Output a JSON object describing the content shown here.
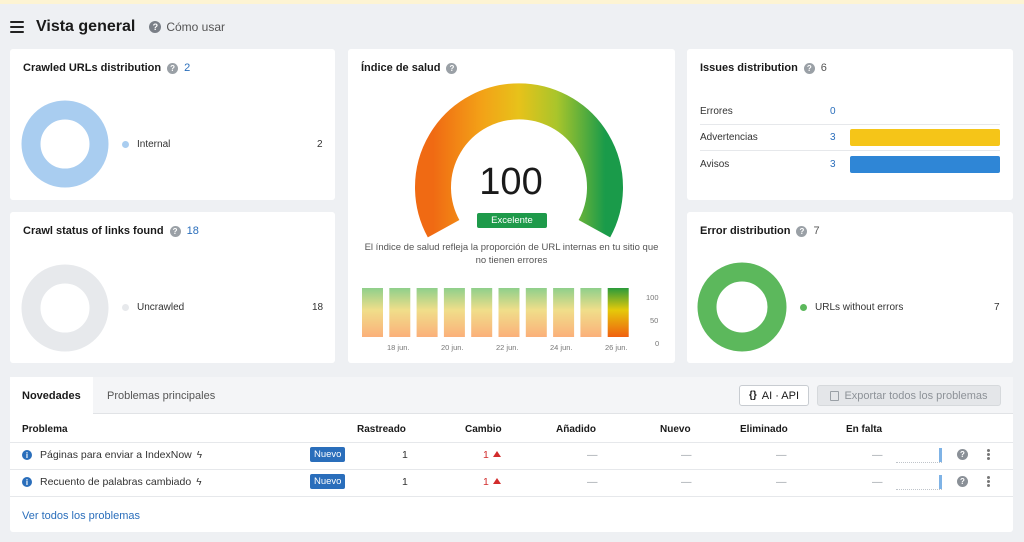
{
  "header": {
    "title": "Vista general",
    "howto": "Cómo usar"
  },
  "crawled": {
    "title": "Crawled URLs distribution",
    "count": "2",
    "legend_label": "Internal",
    "legend_value": "2",
    "color": "#a9cdf0"
  },
  "crawl_status": {
    "title": "Crawl status of links found",
    "count": "18",
    "legend_label": "Uncrawled",
    "legend_value": "18",
    "color": "#e7e9ec"
  },
  "health": {
    "title": "Índice de salud",
    "score": "100",
    "badge": "Excelente",
    "badge_color": "#1e9a4a",
    "description": "El índice de salud refleja la proporción de URL internas en tu sitio que no tienen errores",
    "history_values": [
      100,
      100,
      100,
      100,
      100,
      100,
      100,
      100,
      100,
      100
    ],
    "x_ticks": [
      "18 jun.",
      "20 jun.",
      "22 jun.",
      "24 jun.",
      "26 jun."
    ],
    "y_ticks": [
      "100",
      "50",
      "0"
    ]
  },
  "issues": {
    "title": "Issues distribution",
    "count": "6",
    "rows": [
      {
        "label": "Errores",
        "value": "0",
        "color": "#e0392b"
      },
      {
        "label": "Advertencias",
        "value": "3",
        "color": "#f5c518"
      },
      {
        "label": "Avisos",
        "value": "3",
        "color": "#2f86d6"
      }
    ]
  },
  "error_dist": {
    "title": "Error distribution",
    "count": "7",
    "legend_label": "URLs without errors",
    "legend_value": "7",
    "color": "#5cb85c"
  },
  "bottom": {
    "tabs": [
      "Novedades",
      "Problemas principales"
    ],
    "ai_button": "AI · API",
    "export_button": "Exportar todos los problemas",
    "columns": [
      "Problema",
      "Rastreado",
      "Cambio",
      "Añadido",
      "Nuevo",
      "Eliminado",
      "En falta"
    ],
    "rows": [
      {
        "problem": "Páginas para enviar a IndexNow",
        "badge": "Nuevo",
        "crawled": "1",
        "change": "1",
        "added": "—",
        "new": "—",
        "removed": "—",
        "missing": "—"
      },
      {
        "problem": "Recuento de palabras cambiado",
        "badge": "Nuevo",
        "crawled": "1",
        "change": "1",
        "added": "—",
        "new": "—",
        "removed": "—",
        "missing": "—"
      }
    ],
    "view_all": "Ver todos los problemas"
  }
}
